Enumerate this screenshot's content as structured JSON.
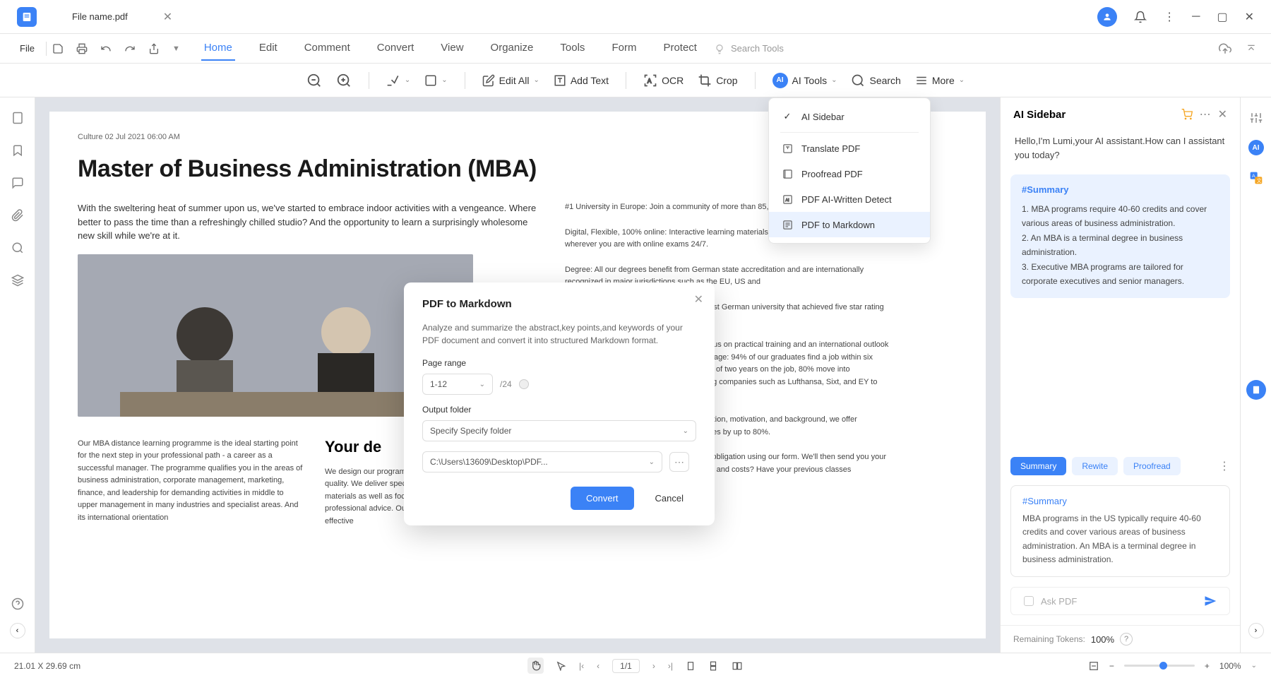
{
  "titlebar": {
    "tab_name": "File name.pdf"
  },
  "menubar": {
    "file": "File",
    "tabs": [
      "Home",
      "Edit",
      "Comment",
      "Convert",
      "View",
      "Organize",
      "Tools",
      "Form",
      "Protect"
    ],
    "active_tab": "Home",
    "search_placeholder": "Search Tools"
  },
  "toolbar": {
    "edit_all": "Edit All",
    "add_text": "Add Text",
    "ocr": "OCR",
    "crop": "Crop",
    "ai_tools": "AI Tools",
    "search": "Search",
    "more": "More"
  },
  "ai_dropdown": {
    "items": [
      "AI Sidebar",
      "Translate PDF",
      "Proofread PDF",
      "PDF AI-Written Detect",
      "PDF to Markdown"
    ],
    "selected": "PDF to Markdown"
  },
  "modal": {
    "title": "PDF to Markdown",
    "desc": "Analyze and summarize the abstract,key points,and keywords of your PDF document and convert it into structured Markdown format.",
    "page_range_label": "Page range",
    "page_range_value": "1-12",
    "page_total": "/24",
    "output_label": "Output folder",
    "output_select": "Specify Specify folder",
    "output_path": "C:\\Users\\13609\\Desktop\\PDF...",
    "convert": "Convert",
    "cancel": "Cancel"
  },
  "document": {
    "meta": "Culture 02 Jul 2021 06:00 AM",
    "title": "Master of Business Administration (MBA)",
    "intro": "With the sweltering heat of summer upon us, we've started to embrace indoor activities with a vengeance. Where better to pass the time than a refreshingly chilled studio? And the opportunity to learn a surprisingly wholesome new skill while we're at it.",
    "body_left": "Our MBA distance learning programme is the ideal starting point for the next step in your professional path - a career as a successful manager. The programme qualifies you in the areas of business administration, corporate management, marketing, finance, and leadership for demanding activities in middle to upper management in many industries and specialist areas. And its international orientation",
    "mid_title": "Your de",
    "body_mid": "We design our programmes to be flexible and innovate and quality. We deliver specialist expertise and innovative learning materials as well as focusing on excellent student services and professional advice. Our programmes are characterised by the effective",
    "right_items": [
      "#1 University in Europe: Join a community of more than 85,000 students",
      "Digital, Flexible, 100% online: Interactive learning materials and a great online platform wherever you are with online exams 24/7.",
      "Degree: All our degrees benefit from German state accreditation and are internationally recognized in major jurisdictions such as the EU, US and",
      "5-star rated University from QS: IU is the first German university that achieved five star rating for Online Learning from QS",
      "Global Focus, Practical Orientation: We focus on practical training and an international outlook which gives IU graduates a decisive advantage: 94% of our graduates find a job within six months of graduation and, after an average of two years on the job, 80% move into management. Plus, we work closely with big companies such as Lufthansa, Sixt, and EY to give you great opportunities and",
      "Flexible Payment: Depending on your situation, motivation, and background, we offer scholarships that can reduce your tuition fees by up to 80%.",
      "Secure your place at IU easily and without obligation using our form. We'll then send you your study agreement. Do you want to save time and costs? Have your previous classes recognised!"
    ]
  },
  "ai_sidebar": {
    "title": "AI Sidebar",
    "greeting": "Hello,I'm Lumi,your AI assistant.How can I assistant you today?",
    "card1_title": "#Summary",
    "card1_body": "1. MBA programs require 40-60 credits and cover various areas of business administration.\n2. An MBA is a terminal degree in business administration.\n3. Executive MBA programs are tailored for corporate executives and senior managers.",
    "chips": [
      "Summary",
      "Rewite",
      "Proofread"
    ],
    "card2_title": "#Summary",
    "card2_body": "MBA programs in the US typically require 40-60 credits and cover various areas of business administration. An MBA is a terminal degree in business administration.",
    "input_placeholder": "Ask PDF",
    "tokens_label": "Remaining Tokens:",
    "tokens_value": "100%"
  },
  "statusbar": {
    "dimensions": "21.01 X 29.69 cm",
    "page": "1/1",
    "zoom": "100%"
  }
}
